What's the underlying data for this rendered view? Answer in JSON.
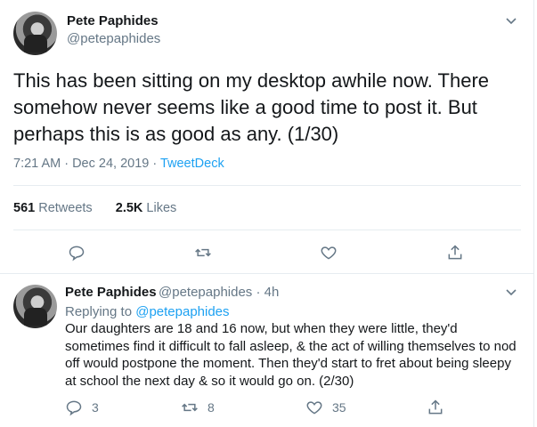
{
  "main": {
    "author_name": "Pete Paphides",
    "author_handle": "@petepaphides",
    "text": "This has been sitting on my desktop awhile now. There somehow never seems like a good time to post it. But perhaps this is as good as any. (1/30)",
    "timestamp": "7:21 AM · Dec 24, 2019 · ",
    "source": "TweetDeck",
    "retweets_count": "561",
    "retweets_label": "Retweets",
    "likes_count": "2.5K",
    "likes_label": "Likes"
  },
  "reply": {
    "author_name": "Pete Paphides",
    "author_handle": "@petepaphides",
    "time_ago": "· 4h",
    "replying_prefix": "Replying to ",
    "replying_to": "@petepaphides",
    "text": "Our daughters are 18 and 16 now, but when they were little, they'd sometimes find it difficult to fall asleep, & the act of willing themselves to nod off would postpone the moment. Then they'd start to fret about being sleepy at school the next day & so it would go on. (2/30)",
    "reply_count": "3",
    "retweet_count": "8",
    "like_count": "35"
  },
  "colors": {
    "accent": "#1da1f2",
    "muted": "#657786",
    "divider": "#e6ecf0"
  },
  "icons": [
    "chevron-down-icon",
    "reply-icon",
    "retweet-icon",
    "like-icon",
    "share-icon"
  ]
}
